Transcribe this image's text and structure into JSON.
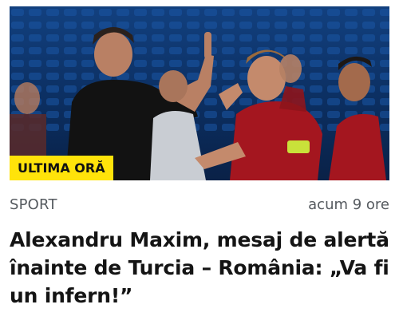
{
  "article": {
    "badge": "ULTIMA ORĂ",
    "category": "SPORT",
    "time": "acum 9 ore",
    "headline": "Alexandru Maxim, mesaj de alertă înainte de Turcia – România: „Va fi un infern!”"
  },
  "colors": {
    "badge_bg": "#ffe30a",
    "badge_text": "#111111",
    "meta_text": "#555a5f",
    "headline_text": "#141414"
  },
  "icons": {
    "image": "football-players-photo"
  }
}
